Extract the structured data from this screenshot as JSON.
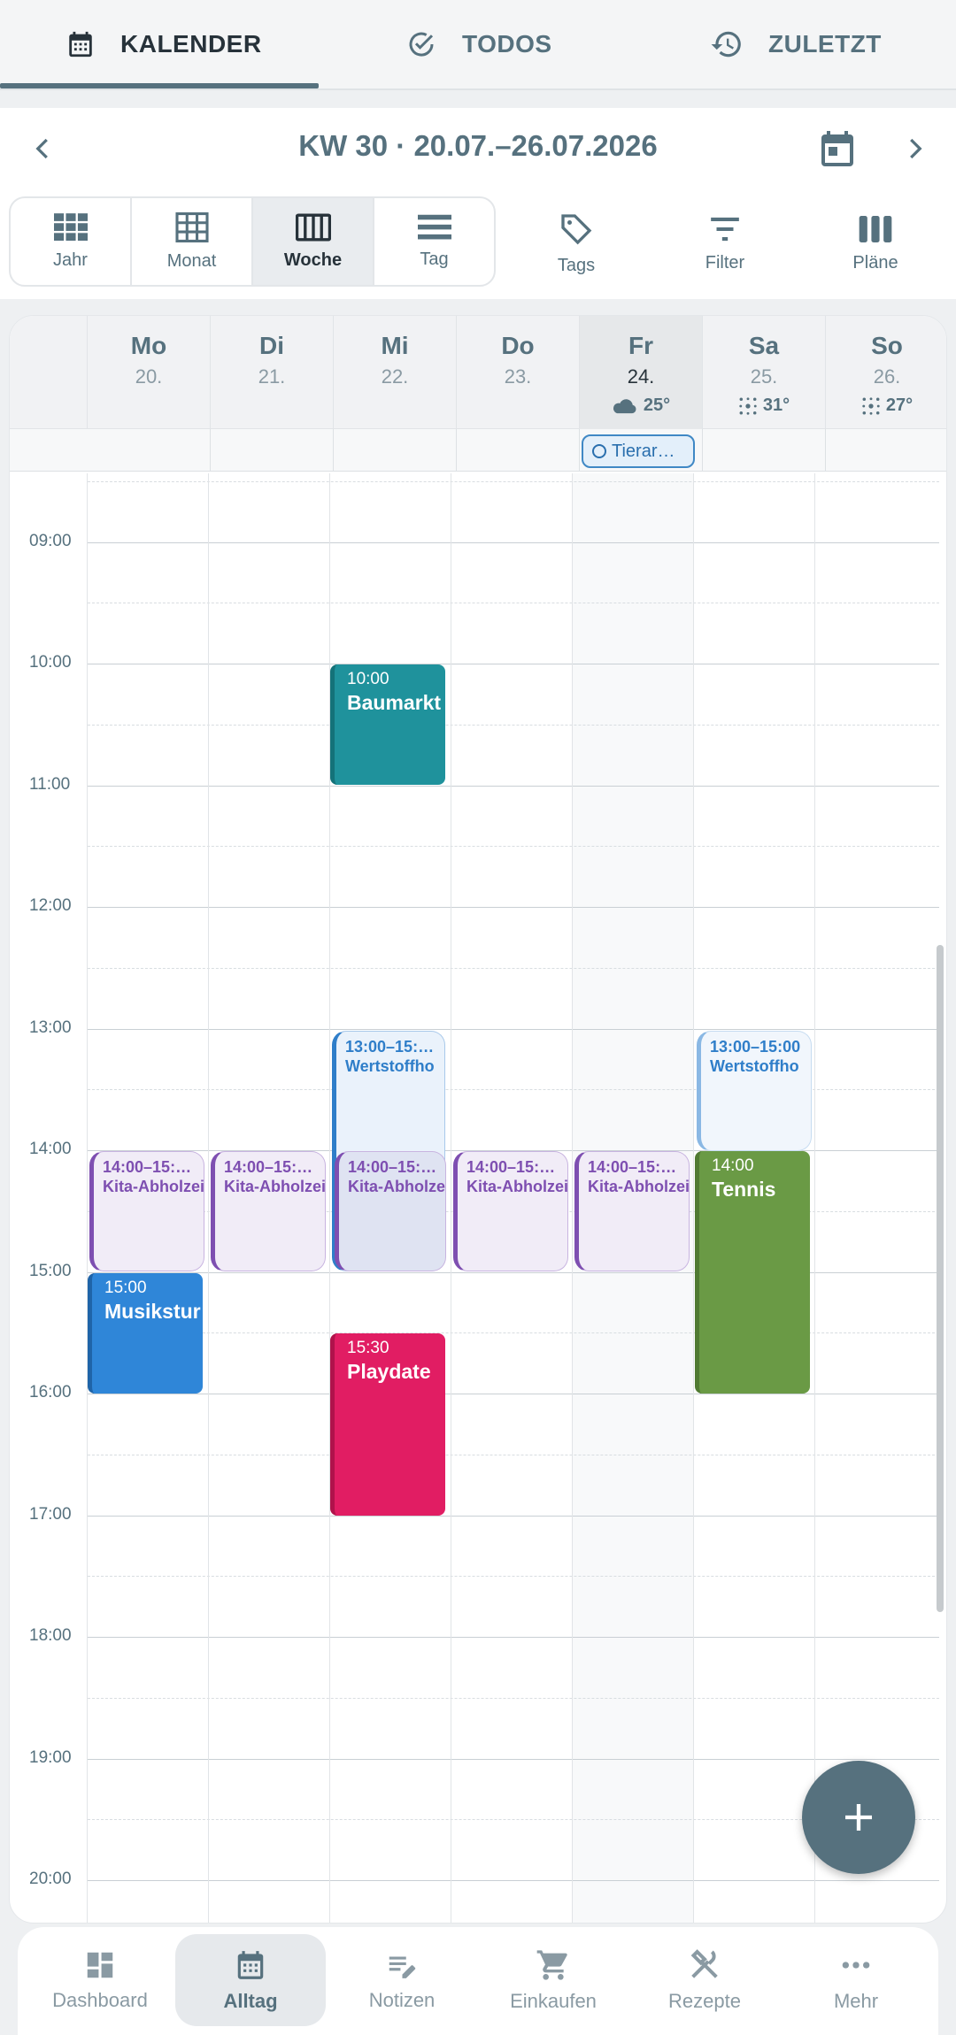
{
  "tabs": [
    {
      "label": "KALENDER",
      "icon": "calendar-icon",
      "active": true
    },
    {
      "label": "TODOS",
      "icon": "check-circle-icon",
      "active": false
    },
    {
      "label": "ZULETZT",
      "icon": "history-icon",
      "active": false
    }
  ],
  "week": {
    "title": "KW 30 · 20.07.–26.07.2026"
  },
  "views": [
    {
      "label": "Jahr",
      "icon": "year-grid-icon"
    },
    {
      "label": "Monat",
      "icon": "month-grid-icon"
    },
    {
      "label": "Woche",
      "icon": "week-columns-icon",
      "active": true
    },
    {
      "label": "Tag",
      "icon": "day-rows-icon"
    }
  ],
  "tools": [
    {
      "label": "Tags",
      "icon": "tag-icon"
    },
    {
      "label": "Filter",
      "icon": "filter-icon"
    },
    {
      "label": "Pläne",
      "icon": "plans-icon"
    }
  ],
  "days": [
    {
      "name": "Mo",
      "date": "20."
    },
    {
      "name": "Di",
      "date": "21."
    },
    {
      "name": "Mi",
      "date": "22."
    },
    {
      "name": "Do",
      "date": "23."
    },
    {
      "name": "Fr",
      "date": "24.",
      "weather": "25°",
      "weather_icon": "cloud-icon",
      "today": true
    },
    {
      "name": "Sa",
      "date": "25.",
      "weather": "31°",
      "weather_icon": "sun-haze-icon"
    },
    {
      "name": "So",
      "date": "26.",
      "weather": "27°",
      "weather_icon": "sun-haze-icon"
    }
  ],
  "allday_event": {
    "label": "Tierar…",
    "day": "Fr"
  },
  "hours": [
    "09:00",
    "10:00",
    "11:00",
    "12:00",
    "13:00",
    "14:00",
    "15:00",
    "16:00",
    "17:00",
    "18:00",
    "19:00",
    "20:00"
  ],
  "events": [
    {
      "day": "Mi",
      "time": "10:00",
      "title": "Baumarkt",
      "color": "#1f929c"
    },
    {
      "day": "Mi",
      "time": "13:00–15:…",
      "title": "Wertstoffho"
    },
    {
      "day": "Sa",
      "time": "13:00–15:00",
      "title": "Wertstoffho"
    },
    {
      "day": "Mo",
      "time": "14:00–15:…",
      "title": "Kita-Abholzeiten"
    },
    {
      "day": "Di",
      "time": "14:00–15:…",
      "title": "Kita-Abholzeiten"
    },
    {
      "day": "Mi",
      "time": "14:00–15:…",
      "title": "Kita-Abholzeiten"
    },
    {
      "day": "Do",
      "time": "14:00–15:…",
      "title": "Kita-Abholzeiten"
    },
    {
      "day": "Fr",
      "time": "14:00–15:…",
      "title": "Kita-Abholzeiten"
    },
    {
      "day": "Sa",
      "time": "14:00",
      "title": "Tennis",
      "color": "#6a9a45"
    },
    {
      "day": "Mo",
      "time": "15:00",
      "title": "Musikstur",
      "color": "#2f86d8"
    },
    {
      "day": "Mi",
      "time": "15:30",
      "title": "Playdate",
      "color": "#e11d63"
    }
  ],
  "bottom_nav": [
    {
      "label": "Dashboard",
      "icon": "dashboard-icon"
    },
    {
      "label": "Alltag",
      "icon": "calendar-icon",
      "active": true
    },
    {
      "label": "Notizen",
      "icon": "note-edit-icon"
    },
    {
      "label": "Einkaufen",
      "icon": "cart-icon"
    },
    {
      "label": "Rezepte",
      "icon": "utensils-icon"
    },
    {
      "label": "Mehr",
      "icon": "more-dots-icon"
    }
  ],
  "fab": {
    "icon": "plus-icon"
  }
}
